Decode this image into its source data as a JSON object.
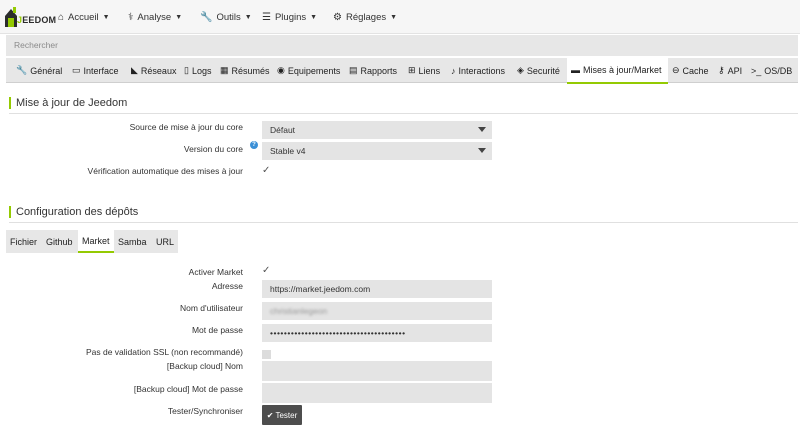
{
  "brand": {
    "logo_text": "JEEDOM"
  },
  "navbar": {
    "items": [
      {
        "label": "Accueil",
        "icon": "home-icon"
      },
      {
        "label": "Analyse",
        "icon": "stethoscope-icon"
      },
      {
        "label": "Outils",
        "icon": "wrench-icon"
      },
      {
        "label": "Plugins",
        "icon": "list-icon"
      },
      {
        "label": "Réglages",
        "icon": "cog-icon"
      }
    ]
  },
  "search": {
    "placeholder": "Rechercher"
  },
  "tabs": [
    {
      "label": "Général",
      "icon": "wrench-icon"
    },
    {
      "label": "Interface",
      "icon": "laptop-icon"
    },
    {
      "label": "Réseaux",
      "icon": "rss-icon"
    },
    {
      "label": "Logs",
      "icon": "file-icon"
    },
    {
      "label": "Résumés",
      "icon": "table-icon"
    },
    {
      "label": "Equipements",
      "icon": "circle-icon"
    },
    {
      "label": "Rapports",
      "icon": "newspaper-icon"
    },
    {
      "label": "Liens",
      "icon": "sitemap-icon"
    },
    {
      "label": "Interactions",
      "icon": "microphone-icon"
    },
    {
      "label": "Securité",
      "icon": "shield-icon"
    },
    {
      "label": "Mises à jour/Market",
      "icon": "credit-card-icon"
    },
    {
      "label": "Cache",
      "icon": "hdd-icon"
    },
    {
      "label": "API",
      "icon": "key-icon"
    },
    {
      "label": "OS/DB",
      "icon": "terminal-icon"
    }
  ],
  "active_tab": "Mises à jour/Market",
  "update_section": {
    "title": "Mise à jour de Jeedom",
    "source_label": "Source de mise à jour du core",
    "source_value": "Défaut",
    "version_label": "Version du core",
    "version_value": "Stable v4",
    "auto_check_label": "Vérification automatique des mises à jour",
    "auto_check": true
  },
  "repos_section": {
    "title": "Configuration des dépôts",
    "subtabs": [
      "Fichier",
      "Github",
      "Market",
      "Samba",
      "URL"
    ],
    "active_subtab": "Market",
    "fields": {
      "enable_label": "Activer Market",
      "enable": true,
      "address_label": "Adresse",
      "address_value": "https://market.jeedom.com",
      "username_label": "Nom d'utilisateur",
      "username_value": "christianlegeon",
      "password_label": "Mot de passe",
      "password_value": "•••••••••••••••••••••••••••••••••••••••",
      "ssl_label": "Pas de validation SSL (non recommandé)",
      "ssl": false,
      "backup_name_label": "[Backup cloud] Nom",
      "backup_name_value": "",
      "backup_pass_label": "[Backup cloud] Mot de passe",
      "backup_pass_value": "",
      "test_label": "Tester/Synchroniser",
      "test_button": "Tester"
    }
  },
  "colors": {
    "accent": "#94ca02",
    "help": "#3a8fd6",
    "button": "#4d4d4d"
  }
}
